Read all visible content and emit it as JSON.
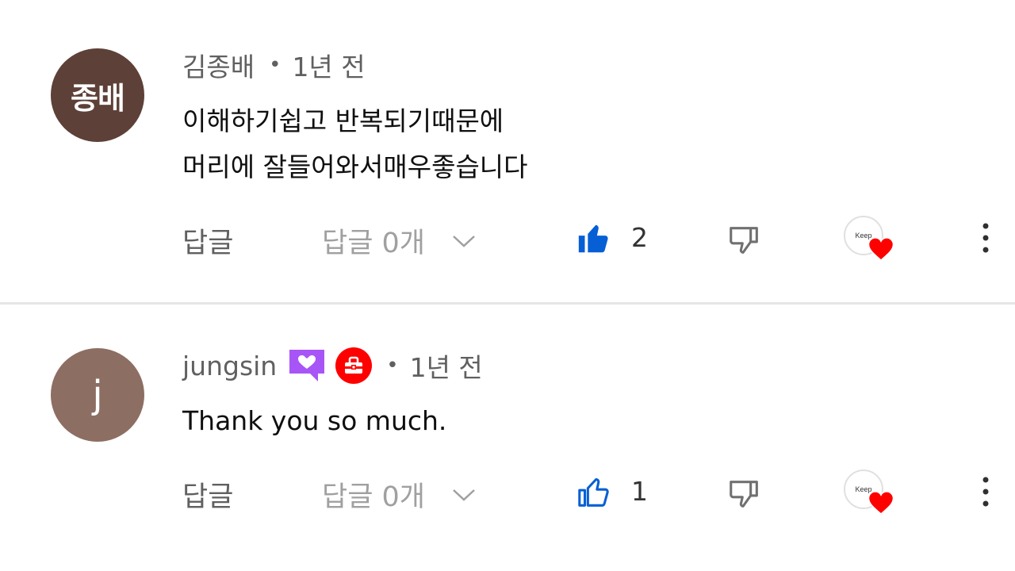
{
  "comments": [
    {
      "avatar_text": "종배",
      "author": "김종배",
      "separator": "•",
      "time": "1년 전",
      "lines": [
        "이해하기쉽고 반복되기때문에",
        "머리에 잘들어와서매우좋습니다"
      ],
      "reply_label": "답글",
      "replies_label": "답글 0개",
      "likes": "2",
      "liked": true,
      "creator_heart_text": "Keep"
    },
    {
      "avatar_text": "j",
      "author": "jungsin",
      "separator": "•",
      "time": "1년 전",
      "lines": [
        "Thank you so much."
      ],
      "reply_label": "답글",
      "replies_label": "답글 0개",
      "likes": "1",
      "liked": false,
      "creator_heart_text": "Keep"
    }
  ],
  "colors": {
    "like_active": "#065fd4",
    "heart": "#ff0000",
    "member_badge": "#a855f7"
  },
  "icons": [
    "thumb-up-icon",
    "thumb-down-icon",
    "chevron-down-icon",
    "heart-icon",
    "more-vert-icon",
    "member-badge-icon",
    "gift-badge-icon"
  ]
}
